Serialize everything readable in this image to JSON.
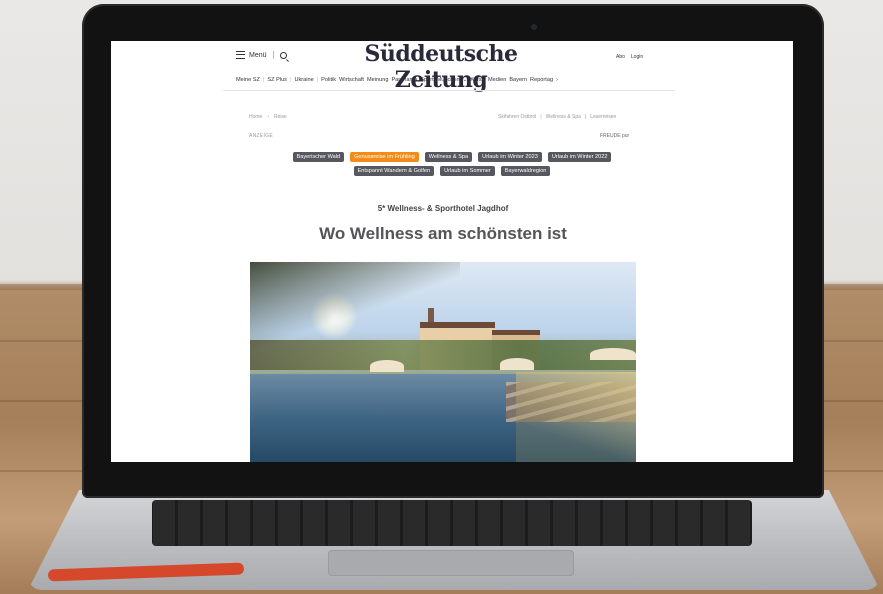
{
  "header": {
    "menu_label": "Menü",
    "masthead": "Süddeutsche Zeitung",
    "abo_label": "Abo",
    "login_label": "Login"
  },
  "nav": {
    "items": [
      "Meine SZ",
      "SZ Plus",
      "Ukraine",
      "Politik",
      "Wirtschaft",
      "Meinung",
      "Panorama",
      "Sport",
      "München",
      "Kultur",
      "Medien",
      "Bayern",
      "Reportag"
    ]
  },
  "breadcrumb": {
    "home": "Home",
    "separator": "›",
    "section": "Reise"
  },
  "partner_links": [
    "Skifahren Osttirol",
    "Wellness & Spa",
    "Leserreisen"
  ],
  "ad_label": "ANZEIGE",
  "sponsor_label": "FREUDE pur",
  "tags": [
    {
      "label": "Bayerischer Wald",
      "active": false
    },
    {
      "label": "Genussreise im Frühling",
      "active": true
    },
    {
      "label": "Wellness & Spa",
      "active": false
    },
    {
      "label": "Urlaub im Winter 2023",
      "active": false
    },
    {
      "label": "Urlaub im Winter 2022",
      "active": false
    },
    {
      "label": "Entspannt Wandern & Golfen",
      "active": false
    },
    {
      "label": "Urlaub im Sommer",
      "active": false
    },
    {
      "label": "Bayerwaldregion",
      "active": false
    }
  ],
  "article": {
    "kicker": "5* Wellness- & Sporthotel Jagdhof",
    "headline": "Wo Wellness am schönsten ist"
  },
  "colors": {
    "tag_active": "#f28c16",
    "tag_default": "#57585f",
    "headline": "#555559"
  }
}
